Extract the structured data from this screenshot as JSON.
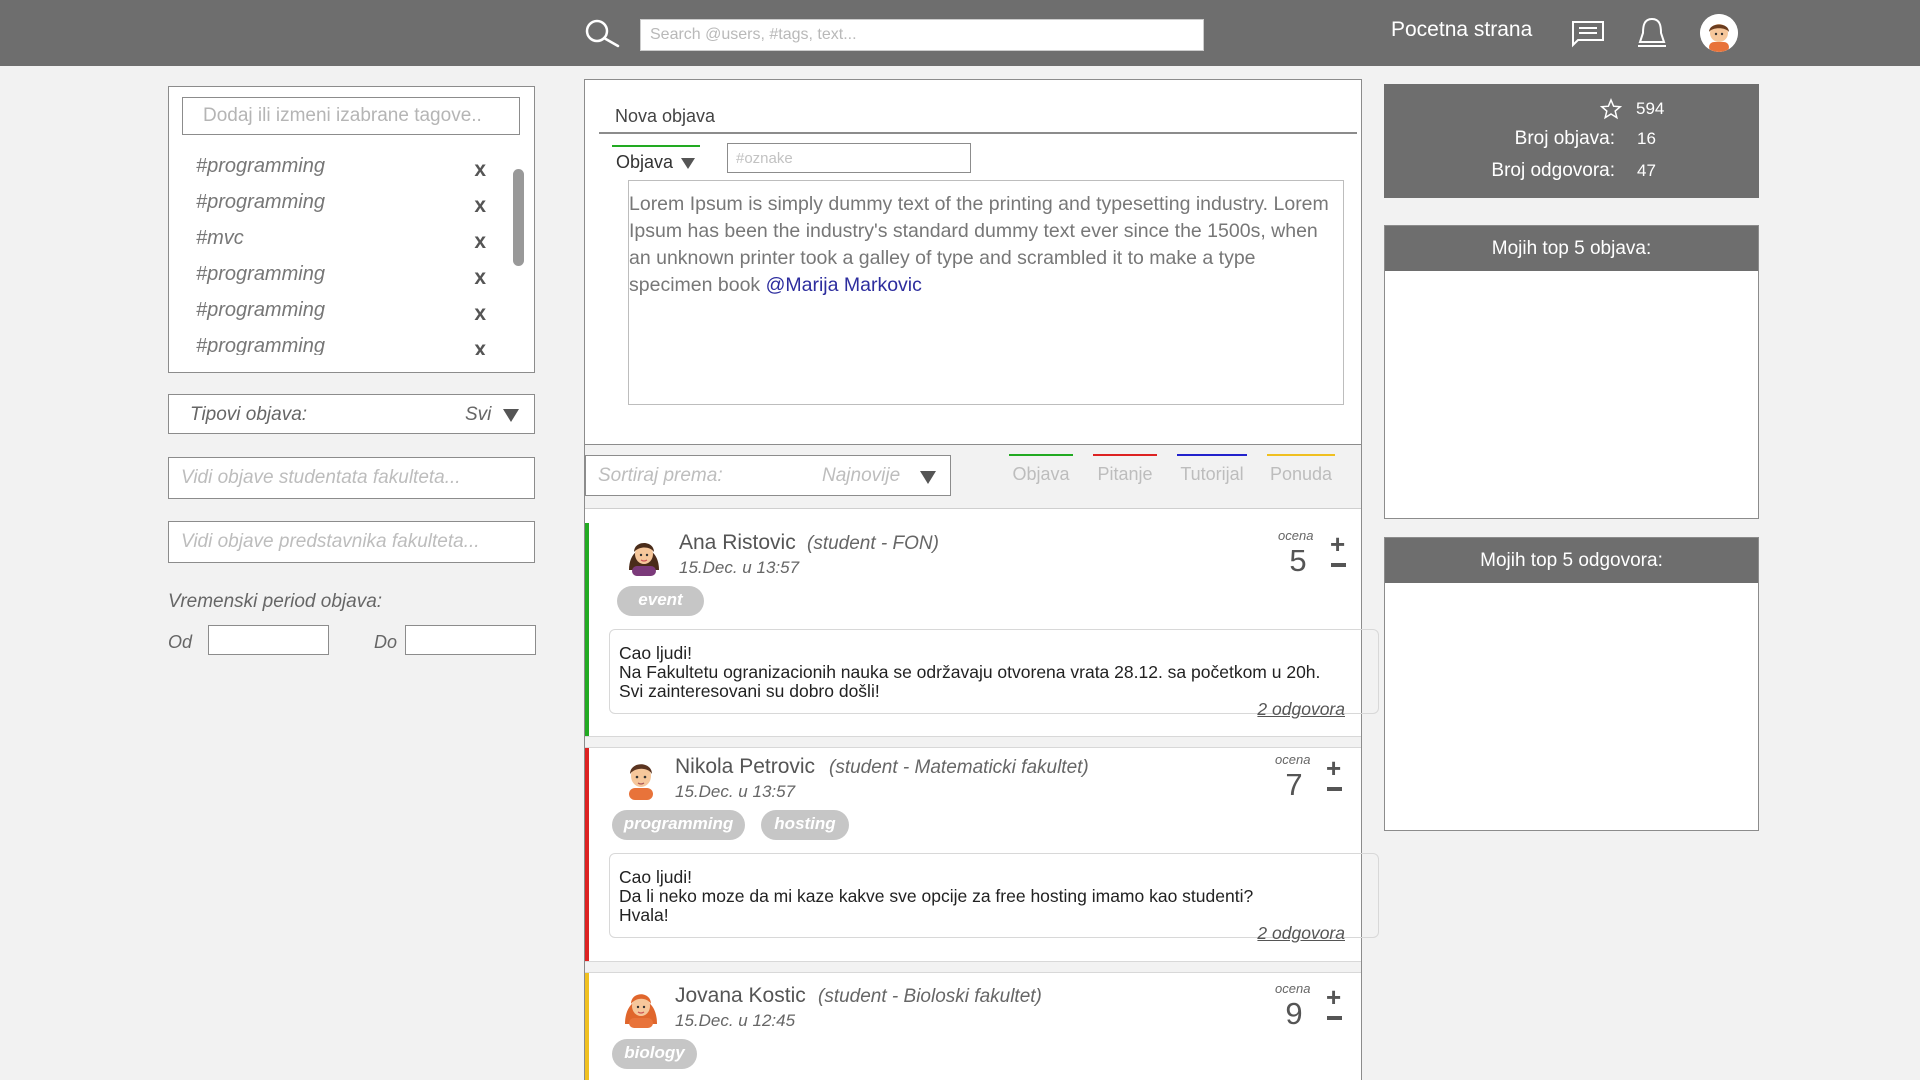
{
  "header": {
    "search_placeholder": "Search @users, #tags, text...",
    "home_link": "Pocetna strana",
    "icons": [
      "search-icon",
      "messages-icon",
      "notifications-icon",
      "user-avatar"
    ]
  },
  "sidebar": {
    "tag_input_placeholder": "Dodaj ili izmeni izabrane tagove..",
    "tags": [
      {
        "label": "#programming",
        "remove": "x"
      },
      {
        "label": "#programming",
        "remove": "x"
      },
      {
        "label": "#mvc",
        "remove": "x"
      },
      {
        "label": "#programming",
        "remove": "x"
      },
      {
        "label": "#programming",
        "remove": "x"
      },
      {
        "label": "#programming",
        "remove": "x"
      }
    ],
    "type_filter": {
      "label": "Tipovi objava:",
      "value": "Svi"
    },
    "students_placeholder": "Vidi objave studentata fakulteta...",
    "reps_placeholder": "Vidi objave predstavnika fakulteta...",
    "period_label": "Vremenski period objava:",
    "from_label": "Od",
    "to_label": "Do"
  },
  "compose": {
    "title": "Nova objava",
    "type_value": "Objava",
    "tags_placeholder": "#oznake",
    "body_text": "Lorem Ipsum is simply dummy text of the printing and typesetting industry. Lorem Ipsum has been the industry's standard dummy text ever since the 1500s, when an unknown printer took a galley of type and scrambled it to make a type specimen book ",
    "mention": "@Marija Markovic"
  },
  "feed_filter": {
    "sort_label": "Sortiraj prema:",
    "sort_value": "Najnovije",
    "types": [
      {
        "label": "Objava",
        "color": "#22aa22"
      },
      {
        "label": "Pitanje",
        "color": "#dd2222"
      },
      {
        "label": "Tutorijal",
        "color": "#2222cc"
      },
      {
        "label": "Ponuda",
        "color": "#f0c020"
      }
    ]
  },
  "posts": [
    {
      "name": "Ana Ristovic",
      "faculty": "(student - FON)",
      "time": "15.Dec. u 13:57",
      "rating_label": "ocena",
      "rating": "5",
      "tags": [
        "event"
      ],
      "body_lines": [
        "Cao ljudi!",
        "Na Fakultetu ogranizacionih nauka se održavaju otvorena vrata 28.12. sa početkom u 20h.",
        "Svi zainteresovani su dobro došli!"
      ],
      "replies": "2 odgovora",
      "stripe_color": "#22aa22",
      "avatar": "woman-avatar"
    },
    {
      "name": "Nikola Petrovic",
      "faculty": "(student - Matematicki fakultet)",
      "time": "15.Dec. u 13:57",
      "rating_label": "ocena",
      "rating": "7",
      "tags": [
        "programming",
        "hosting"
      ],
      "body_lines": [
        "Cao ljudi!",
        "Da li neko moze da mi kaze kakve sve opcije za free hosting imamo kao studenti?",
        "Hvala!"
      ],
      "replies": "2 odgovora",
      "stripe_color": "#dd2222",
      "avatar": "man-avatar"
    },
    {
      "name": "Jovana Kostic",
      "faculty": "(student - Bioloski fakultet)",
      "time": "15.Dec. u 12:45",
      "rating_label": "ocena",
      "rating": "9",
      "tags": [
        "biology"
      ],
      "body_lines": [],
      "replies": "",
      "stripe_color": "#f0c020",
      "avatar": "redhead-avatar"
    }
  ],
  "stats": {
    "points": "594",
    "posts_label": "Broj objava:",
    "posts_value": "16",
    "answers_label": "Broj odgovora:",
    "answers_value": "47"
  },
  "top_posts": {
    "title": "Mojih top 5 objava:"
  },
  "top_answers": {
    "title": "Mojih top 5 odgovora:"
  }
}
